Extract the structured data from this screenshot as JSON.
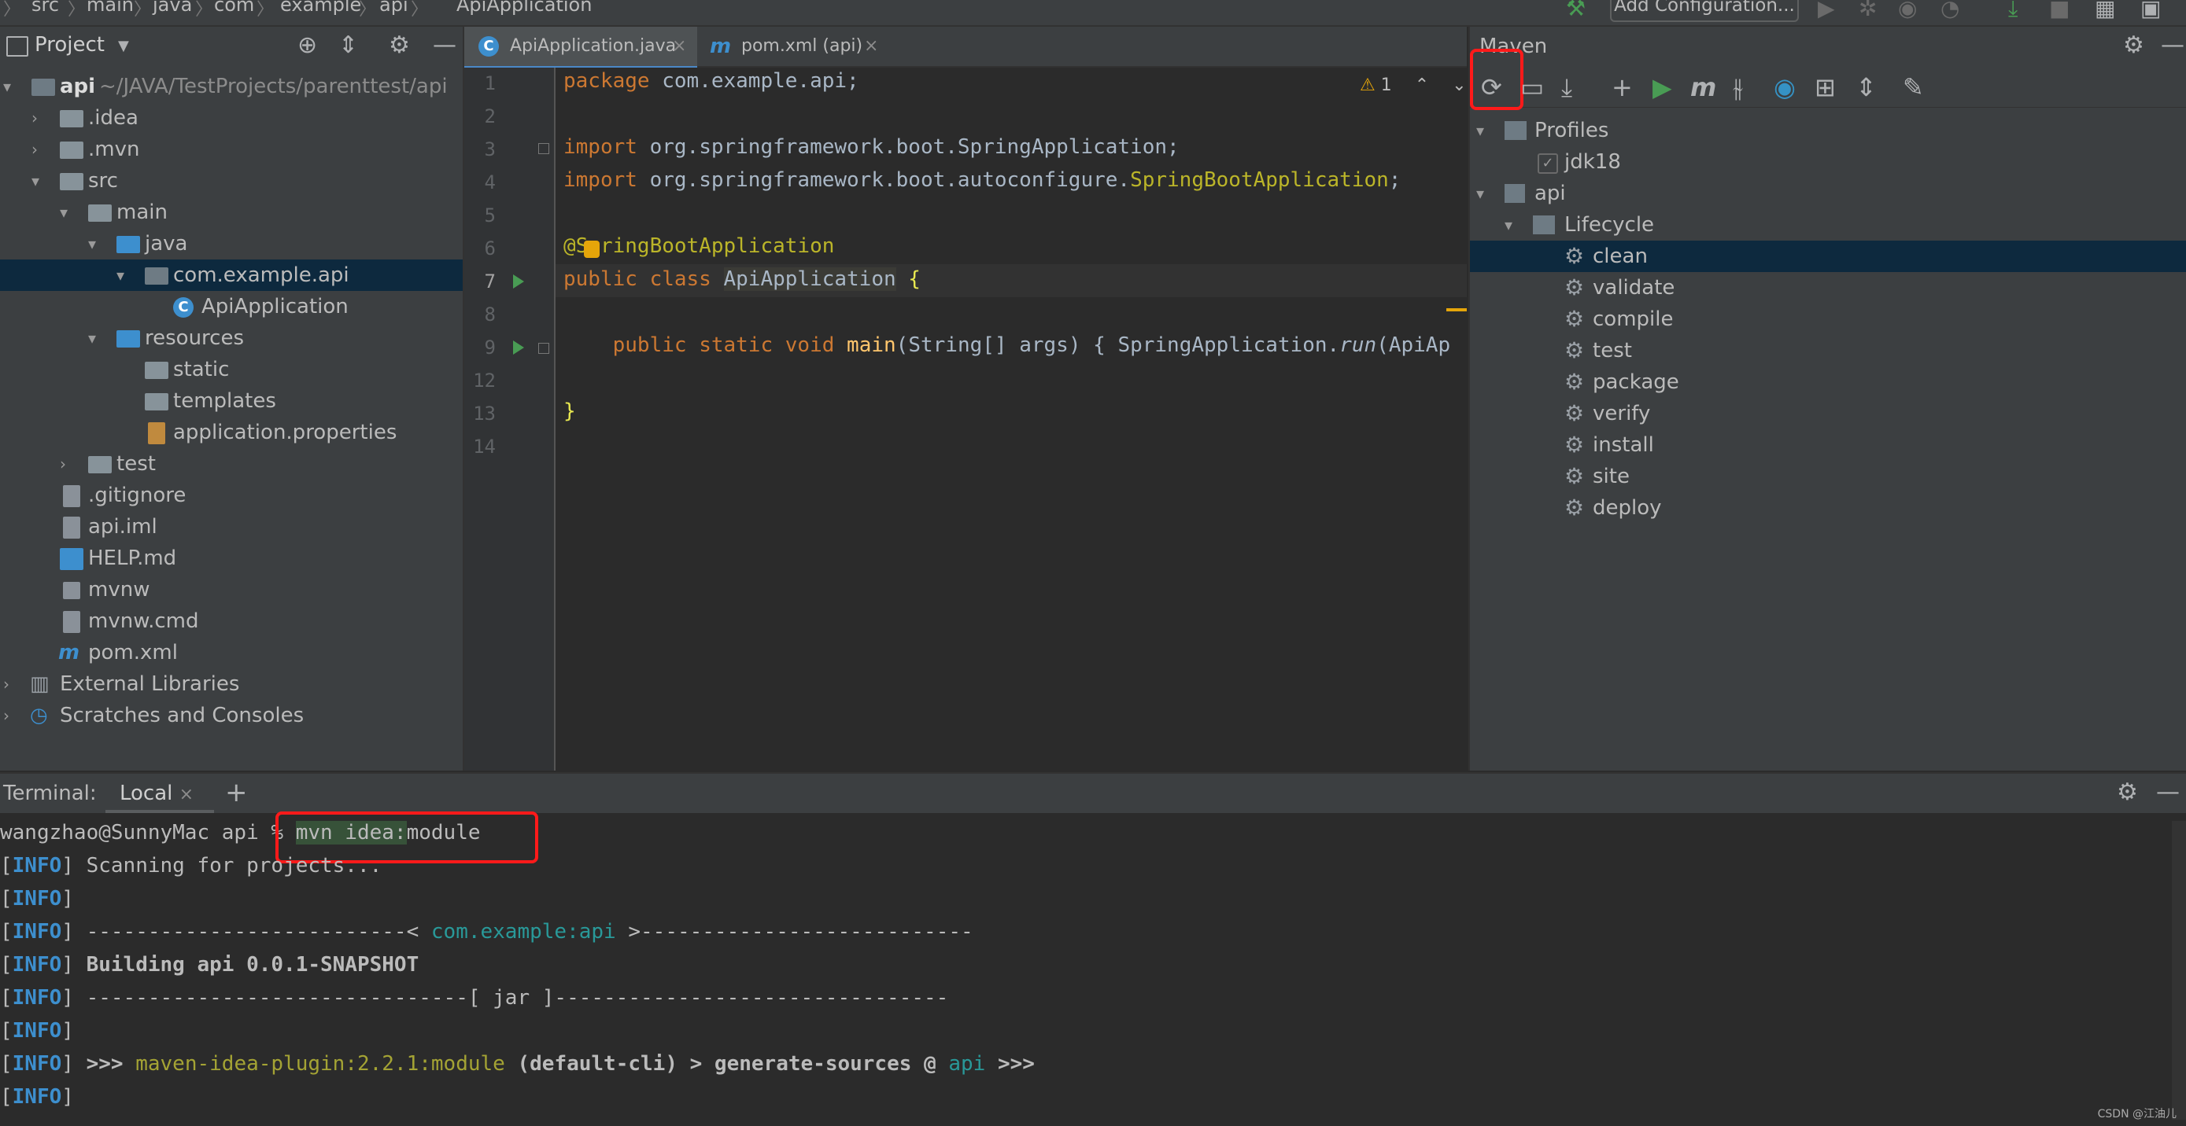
{
  "breadcrumb": [
    "src",
    "main",
    "java",
    "com",
    "example",
    "api",
    "ApiApplication"
  ],
  "toolbar": {
    "run_config_label": "Add Configuration..."
  },
  "project_panel": {
    "title": "Project",
    "tree": [
      {
        "label": "api",
        "suffix": "~/JAVA/TestProjects/parenttest/api",
        "icon": "module-folder-icon"
      },
      {
        "label": ".idea",
        "icon": "folder-icon"
      },
      {
        "label": ".mvn",
        "icon": "folder-icon"
      },
      {
        "label": "src",
        "icon": "folder-icon"
      },
      {
        "label": "main",
        "icon": "folder-icon"
      },
      {
        "label": "java",
        "icon": "source-folder-icon"
      },
      {
        "label": "com.example.api",
        "icon": "package-icon"
      },
      {
        "label": "ApiApplication",
        "icon": "spring-class-icon"
      },
      {
        "label": "resources",
        "icon": "resource-folder-icon"
      },
      {
        "label": "static",
        "icon": "folder-icon"
      },
      {
        "label": "templates",
        "icon": "folder-icon"
      },
      {
        "label": "application.properties",
        "icon": "properties-file-icon"
      },
      {
        "label": "test",
        "icon": "folder-icon"
      },
      {
        "label": ".gitignore",
        "icon": "gitignore-file-icon"
      },
      {
        "label": "api.iml",
        "icon": "iml-file-icon"
      },
      {
        "label": "HELP.md",
        "icon": "markdown-file-icon"
      },
      {
        "label": "mvnw",
        "icon": "script-file-icon"
      },
      {
        "label": "mvnw.cmd",
        "icon": "text-file-icon"
      },
      {
        "label": "pom.xml",
        "icon": "maven-file-icon"
      },
      {
        "label": "External Libraries",
        "icon": "libraries-icon"
      },
      {
        "label": "Scratches and Consoles",
        "icon": "scratches-icon"
      }
    ]
  },
  "editor": {
    "tabs": [
      "ApiApplication.java",
      "pom.xml (api)"
    ],
    "warning_count": "1",
    "line_numbers": [
      "1",
      "2",
      "3",
      "4",
      "5",
      "6",
      "7",
      "8",
      "9",
      "12",
      "13",
      "14"
    ],
    "code": {
      "l1_kw": "package",
      "l1_rest": " com.example.api;",
      "l3_kw": "import",
      "l3_rest": " org.springframework.boot.SpringApplication;",
      "l4_kw": "import",
      "l4_rest": " org.springframework.boot.autoconfigure.",
      "l4_cls": "SpringBootApplication",
      "l4_end": ";",
      "l6": "@SpringBootApplication",
      "l7_kw": "public class",
      "l7_cls": "ApiApplication",
      "l7_brace": " {",
      "l9_kw": "public static void",
      "l9_fn": "main",
      "l9_args": "(String[] args)",
      "l9_body1": " { SpringApplication.",
      "l9_run": "run",
      "l9_body2": "(ApiAp",
      "l13": "}"
    }
  },
  "maven": {
    "title": "Maven",
    "profiles_label": "Profiles",
    "profile": "jdk18",
    "project": "api",
    "lifecycle_label": "Lifecycle",
    "goals": [
      "clean",
      "validate",
      "compile",
      "test",
      "package",
      "verify",
      "install",
      "site",
      "deploy"
    ]
  },
  "terminal": {
    "title": "Terminal:",
    "tab": "Local",
    "prompt": "wangzhao@SunnyMac api % ",
    "cmd1": "mvn idea:",
    "cmd2": "module",
    "info_tag": "INFO",
    "lines": {
      "scanning": " Scanning for projects...",
      "dash1a": " --------------------------< ",
      "artifact": "com.example:api",
      "dash1b": " >---------------------------",
      "building": " Building api 0.0.1-SNAPSHOT",
      "dash2": " -------------------------------[ jar ]--------------------------------",
      "plugin_pre": " >>> ",
      "plugin": "maven-idea-plugin:2.2.1:module",
      "plugin_mid": " (default-cli) > generate-sources @ ",
      "plugin_mod": "api",
      "plugin_end": " >>>"
    }
  },
  "watermark": "CSDN @江油儿",
  "colors": {
    "highlight_box": "#ff1a1a",
    "selection": "#0d293e",
    "accent": "#4a88c7"
  }
}
